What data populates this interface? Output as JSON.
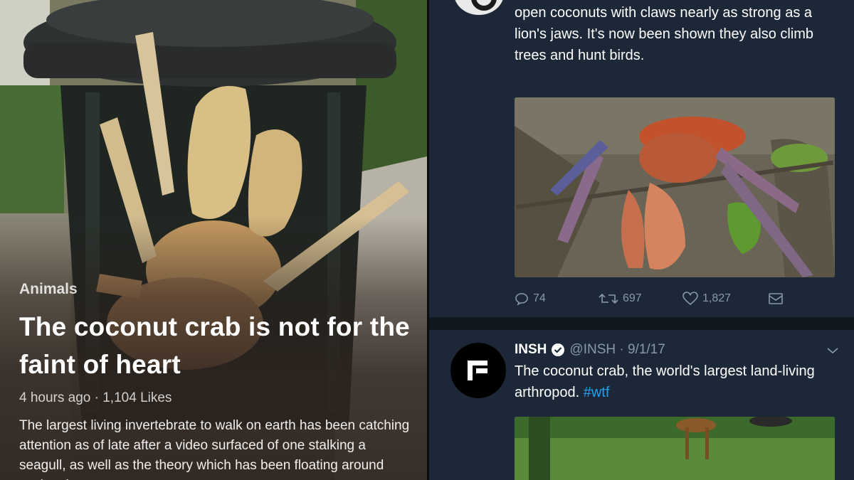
{
  "article": {
    "category": "Animals",
    "headline": "The coconut crab is not for the faint of heart",
    "meta": "4 hours ago · 1,104 Likes",
    "summary": "The largest living invertebrate to walk on earth has been catching attention as of late after a video surfaced of one stalking a seagull, as well as the theory which has been floating around saying they"
  },
  "tweet1": {
    "text": "open coconuts with claws nearly as strong as a lion's jaws. It's now been shown they also climb trees and hunt birds.",
    "actions": {
      "replies": "74",
      "retweets": "697",
      "likes": "1,827"
    }
  },
  "tweet2": {
    "name": "INSH",
    "handle": "@INSH · 9/1/17",
    "text": "The coconut crab, the world's largest land-living arthropod.",
    "hashtag": "#wtf"
  },
  "colors": {
    "twitter_bg": "#1c2838",
    "muted": "#8899a6",
    "link": "#1da1f2"
  },
  "icons": [
    "reply-icon",
    "retweet-icon",
    "like-icon",
    "message-icon",
    "verified-icon",
    "chevron-down-icon"
  ]
}
